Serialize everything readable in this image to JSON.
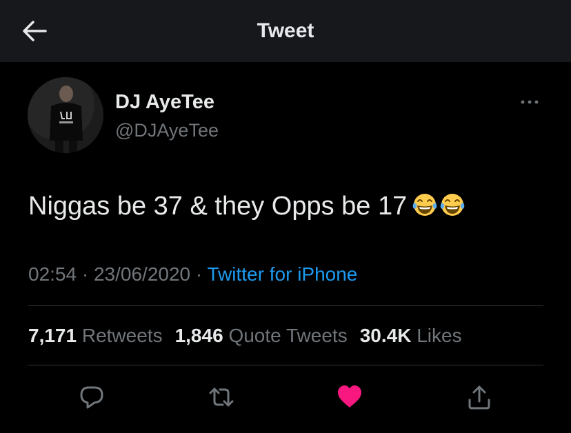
{
  "header": {
    "title": "Tweet"
  },
  "author": {
    "name": "DJ AyeTee",
    "handle": "@DJAyeTee"
  },
  "tweet": {
    "text": "Niggas be 37 & they Opps be 17",
    "emojis": [
      "face-with-tears-of-joy",
      "face-with-tears-of-joy"
    ],
    "time": "02:54",
    "date": "23/06/2020",
    "source": "Twitter for iPhone"
  },
  "stats": {
    "retweets_count": "7,171",
    "retweets_label": "Retweets",
    "quotes_count": "1,846",
    "quotes_label": "Quote Tweets",
    "likes_count": "30.4K",
    "likes_label": "Likes"
  },
  "colors": {
    "header_bg": "#16181c",
    "text": "#e7e9ea",
    "muted": "#71767b",
    "link": "#1d9bf0",
    "like": "#f91880"
  }
}
